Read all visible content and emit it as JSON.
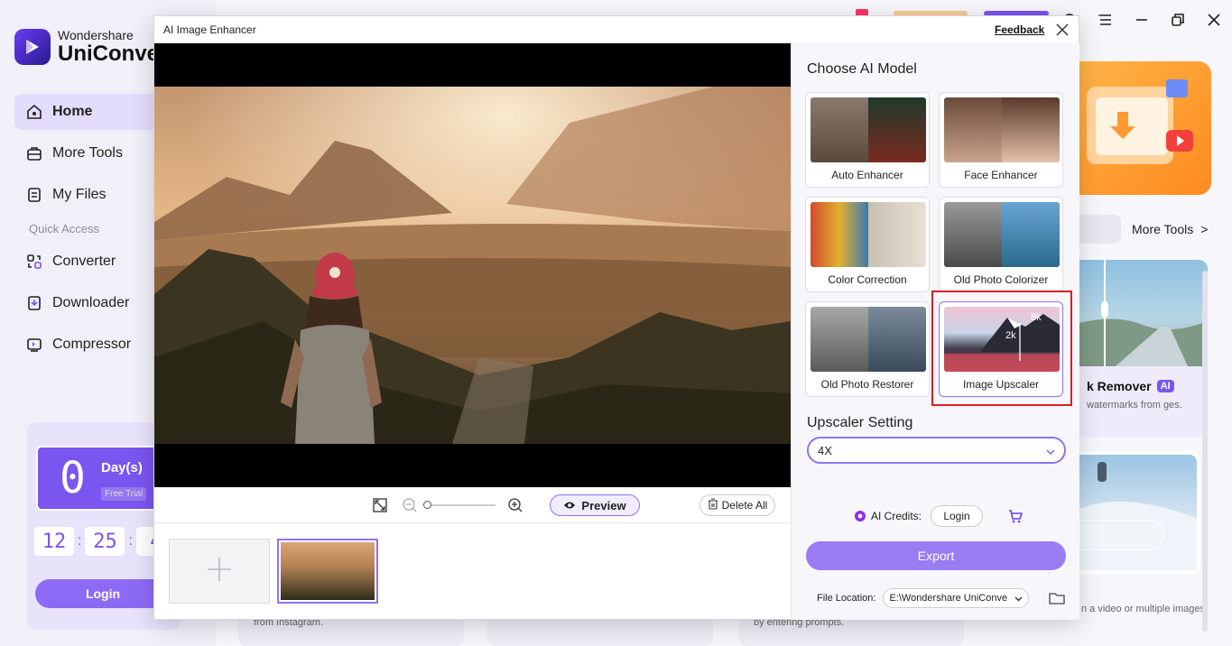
{
  "brand": {
    "line1": "Wondershare",
    "line2": "UniConve"
  },
  "sidebar": {
    "items": [
      {
        "label": "Home"
      },
      {
        "label": "More Tools"
      },
      {
        "label": "My Files"
      }
    ],
    "quick_access_label": "Quick Access",
    "quick_items": [
      {
        "label": "Converter"
      },
      {
        "label": "Downloader"
      },
      {
        "label": "Compressor"
      }
    ]
  },
  "trial": {
    "days_value": "0",
    "days_label": "Day(s)",
    "free_trial": "Free Trial",
    "timer": [
      "12",
      "25",
      "4"
    ],
    "login_label": "Login"
  },
  "main": {
    "more_tools_link": "More Tools",
    "watermark_card": {
      "title": "k Remover",
      "ai_badge": "AI",
      "desc": "watermarks from ges."
    },
    "snow_card_desc": "n a video or multiple images.",
    "bottom_desc_1": "from Instagram.",
    "bottom_desc_2": "by entering prompts."
  },
  "dialog": {
    "title": "AI Image Enhancer",
    "feedback": "Feedback",
    "toolbar": {
      "preview_label": "Preview",
      "delete_all_label": "Delete All"
    },
    "right_panel": {
      "choose_title": "Choose AI Model",
      "models": [
        {
          "label": "Auto Enhancer"
        },
        {
          "label": "Face Enhancer"
        },
        {
          "label": "Color Correction"
        },
        {
          "label": "Old Photo Colorizer"
        },
        {
          "label": "Old Photo Restorer"
        },
        {
          "label": "Image Upscaler",
          "badge_hi": "8k",
          "badge_lo": "2k"
        }
      ],
      "upscaler_title": "Upscaler Setting",
      "upscaler_value": "4X",
      "credits_label": "AI Credits:",
      "credits_login": "Login",
      "export_label": "Export",
      "file_location_label": "File Location:",
      "file_location_value": "E:\\Wondershare UniConve"
    }
  },
  "colors": {
    "accent": "#8f73ef",
    "highlight": "#d61f26",
    "export": "#9a7cf4"
  }
}
